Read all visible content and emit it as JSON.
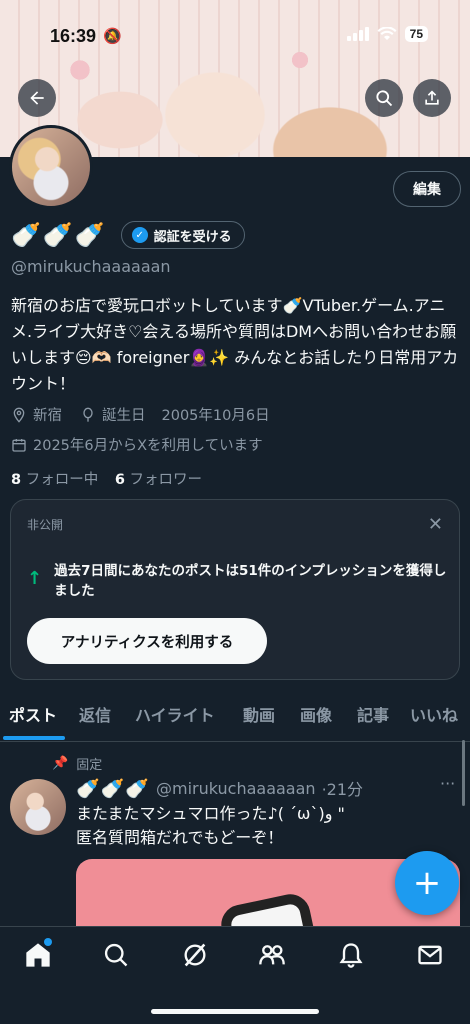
{
  "status_bar": {
    "time": "16:39",
    "battery": "75"
  },
  "profile": {
    "edit_label": "編集",
    "name_emoji": "🍼🍼🍼",
    "verify_label": "認証を受ける",
    "handle": "@mirukuchaaaaaan",
    "bio": "新宿のお店で愛玩ロボットしています🍼VTuber.ゲーム.アニメ.ライブ大好き♡会える場所や質問はDMへお問い合わせお願いします😔🫶🏻 foreigner🧕✨ みんなとお話したり日常用アカウント！",
    "location": "新宿",
    "birthday_label": "誕生日",
    "birthday": "2005年10月6日",
    "joined": "2025年6月からXを利用しています",
    "following_count": "8",
    "following_label": "フォロー中",
    "followers_count": "6",
    "followers_label": "フォロワー"
  },
  "analytics_card": {
    "private_label": "非公開",
    "message": "過去7日間にあなたのポストは51件のインプレッションを獲得しました",
    "button_label": "アナリティクスを利用する"
  },
  "tabs": [
    "ポスト",
    "返信",
    "ハイライト",
    "動画",
    "画像",
    "記事",
    "いいね"
  ],
  "pinned_post": {
    "pinned_label": "固定",
    "name_emoji": "🍼🍼🍼",
    "handle": "@mirukuchaaaaaan",
    "time": "·21分",
    "text": "またまたマシュマロ作った♪( ˊωˋ)و \"\n匿名質問箱だれでもどーぞ！",
    "image_color": "#f08e96"
  },
  "colors": {
    "accent": "#1d9bf0",
    "background": "#15202b",
    "success": "#00ba7c"
  }
}
